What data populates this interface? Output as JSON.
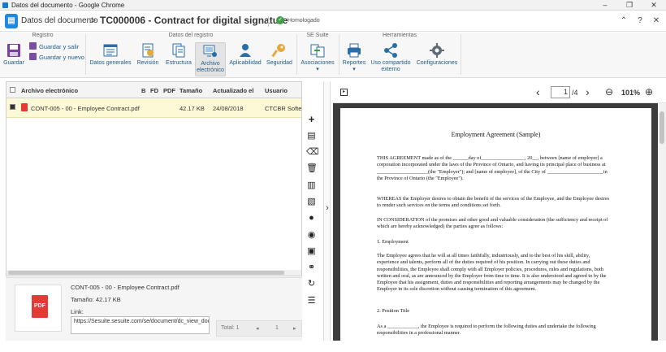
{
  "chrome": {
    "window_title": "Datos del documento - Google Chrome"
  },
  "header": {
    "section": "Datos del documento",
    "separator": ">",
    "title": "TC000006 - Contract for digital signature",
    "status": "Homologado"
  },
  "ribbon": {
    "groups": {
      "registro": "Registro",
      "datos_registro": "Datos del registro",
      "se_suite": "SE Suite",
      "herramientas": "Herramientas"
    },
    "guardar": "Guardar",
    "guardar_salir": "Guardar y salir",
    "guardar_nuevo": "Guardar y nuevo",
    "datos_generales": "Datos generales",
    "revision": "Revisión",
    "estructura": "Estructura",
    "archivo_l1": "Archivo",
    "archivo_l2": "electrónico",
    "aplicabilidad": "Aplicabilidad",
    "seguridad": "Seguridad",
    "asociaciones": "Asociaciones",
    "reportes": "Reportes",
    "uso_l1": "Uso compartido",
    "uso_l2": "externo",
    "configuraciones": "Configuraciones",
    "dropdown_arrow": "▾"
  },
  "grid": {
    "headers": {
      "archivo": "Archivo electrónico",
      "b": "B",
      "fd": "FD",
      "pdf": "PDF",
      "tamano": "Tamaño",
      "actualizado": "Actualizado el",
      "usuario": "Usuario"
    },
    "row": {
      "archivo": "CONT-005 - 00 - Employee Contract.pdf",
      "tamano": "42.17 KB",
      "actualizado": "24/08/2018",
      "usuario": "CTCBR Softexp"
    }
  },
  "detail": {
    "filename": "CONT-005 - 00 - Employee Contract.pdf",
    "size_label": "Tamaño: 42.17 KB",
    "link_label": "Link:",
    "link_value": "https://Sesuite.sesuite.com/se/document/dc_view_document/api_view_document.php?",
    "pdf_label": "PDF",
    "total": "Total: 1",
    "page": "1"
  },
  "viewer": {
    "page_current": "1",
    "page_total": "/4",
    "zoom": "101%"
  },
  "document": {
    "title": "Employment Agreement (Sample)",
    "p1": "THIS AGREEMENT made as of the ______day of_________________, 20__, between [name of employer] a corporation incorporated under the laws of the Province of Ontario, and having its principal place of business at ____________________(the \"Employer\"); and [name of employee], of the City of ______________________in the Province of Ontario (the \"Employee\").",
    "p2": "WHEREAS the Employer desires to obtain the benefit of the services of the Employee, and the Employee desires to render such services on the terms and conditions set forth.",
    "p3": "IN CONSIDERATION of the promises and other good and valuable consideration (the sufficiency and receipt of which are hereby acknowledged) the parties agree as follows:",
    "h1": "1. Employment",
    "p4": "The Employee agrees that he will at all times faithfully, industriously, and to the best of his skill, ability, experience and talents, perform all of the duties required of his position. In carrying out these duties and responsibilities, the Employee shall comply with all Employer policies, procedures, rules and regulations, both written and oral, as are announced by the Employer from time to time. It is also understood and agreed to by the Employee that his assignment, duties and responsibilities and reporting arrangements may be changed by the Employer in its sole discretion without causing termination of this agreement.",
    "h2": "2. Position Title",
    "p5": "As a ____________, the Employee is required to perform the following duties and undertake the following responsibilities in a professional manner."
  }
}
